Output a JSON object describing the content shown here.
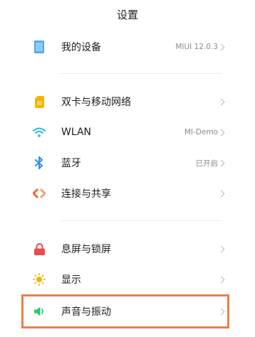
{
  "header": {
    "title": "设置"
  },
  "sections": [
    {
      "items": [
        {
          "label": "我的设备",
          "value": "MIUI 12.0.3",
          "icon": "device-icon",
          "icon_color": "#4aa6f0"
        }
      ]
    },
    {
      "items": [
        {
          "label": "双卡与移动网络",
          "value": "",
          "icon": "sim-card-icon",
          "icon_color": "#f4b400"
        },
        {
          "label": "WLAN",
          "value": "MI-Demo",
          "icon": "wifi-icon",
          "icon_color": "#2bb5e0"
        },
        {
          "label": "蓝牙",
          "value": "已开启",
          "icon": "bluetooth-icon",
          "icon_color": "#2b8fe6"
        },
        {
          "label": "连接与共享",
          "value": "",
          "icon": "share-icon",
          "icon_color": "#e96a3c"
        }
      ]
    },
    {
      "items": [
        {
          "label": "息屏与锁屏",
          "value": "",
          "icon": "lock-icon",
          "icon_color": "#ea4b4b"
        },
        {
          "label": "显示",
          "value": "",
          "icon": "brightness-icon",
          "icon_color": "#f3b400"
        },
        {
          "label": "声音与振动",
          "value": "",
          "icon": "speaker-icon",
          "icon_color": "#2ec46d"
        }
      ]
    }
  ],
  "highlight_color": "#ed7d4a"
}
